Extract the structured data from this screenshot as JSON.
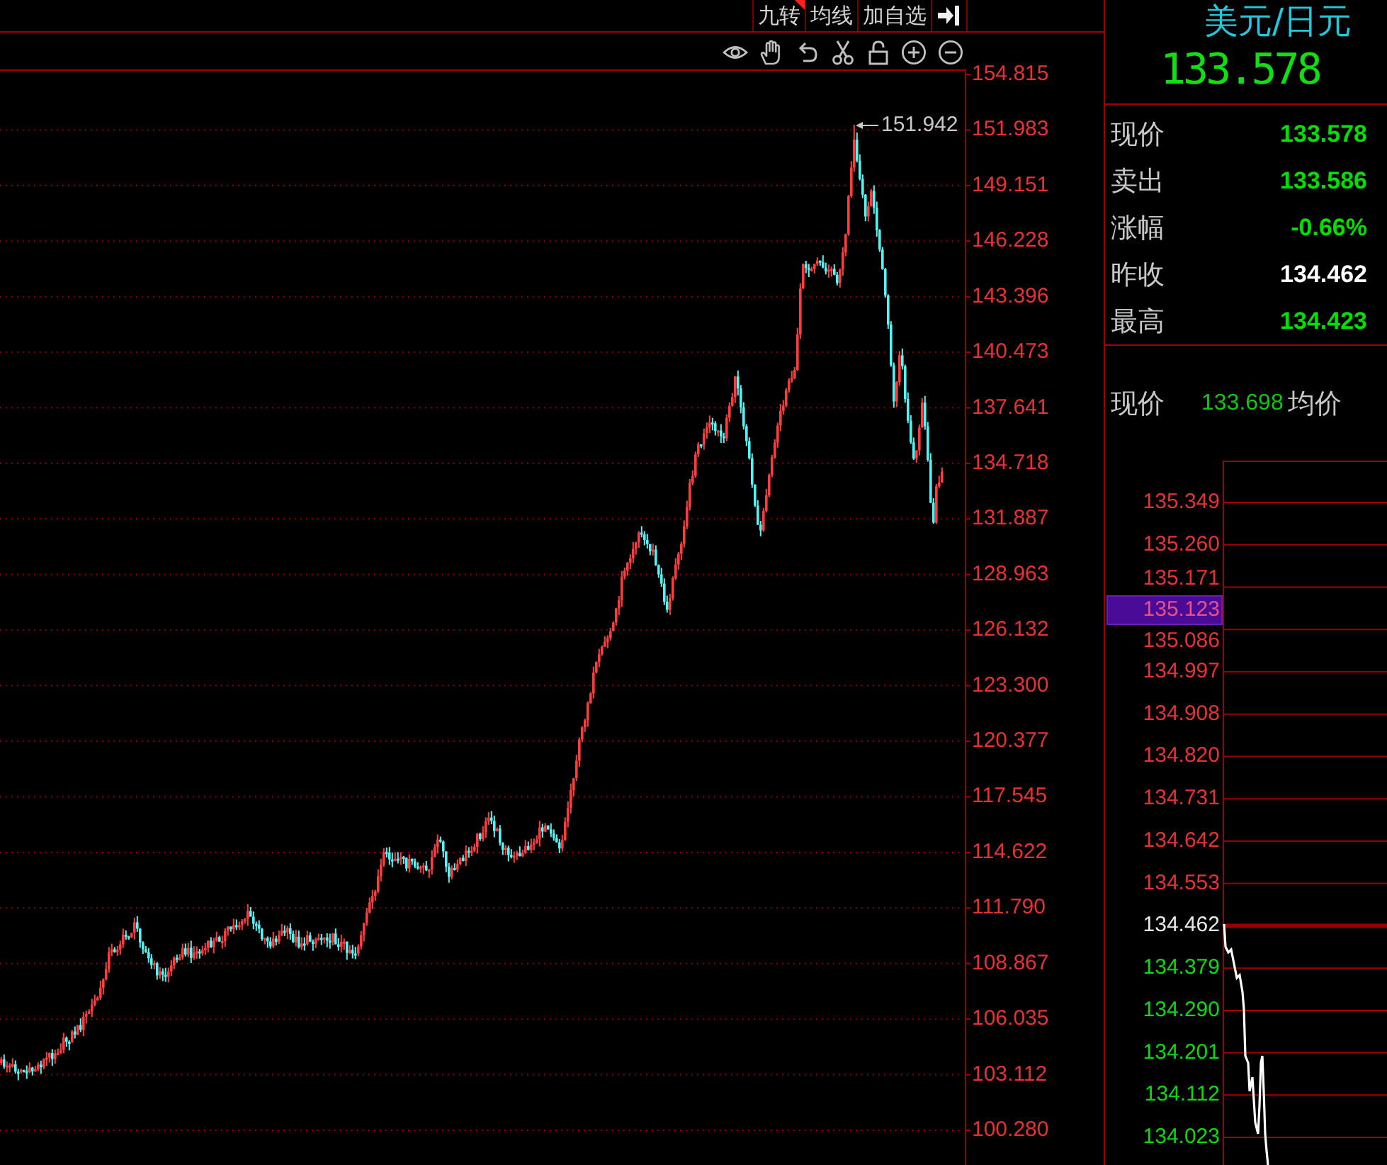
{
  "toolbar": {
    "buttons": [
      {
        "label": "九转",
        "flagged": true
      },
      {
        "label": "均线",
        "flagged": false
      },
      {
        "label": "加自选",
        "flagged": false
      }
    ]
  },
  "main_chart": {
    "axis_labels": [
      "154.815",
      "151.983",
      "149.151",
      "146.228",
      "143.396",
      "140.473",
      "137.641",
      "134.718",
      "131.887",
      "128.963",
      "126.132",
      "123.300",
      "120.377",
      "117.545",
      "114.622",
      "111.790",
      "108.867",
      "106.035",
      "103.112",
      "100.280"
    ],
    "peak_label": "151.942"
  },
  "quote_panel": {
    "symbol": "美元/日元",
    "last_price": "133.578",
    "rows": [
      {
        "label": "现价",
        "value": "133.578",
        "kind": "down"
      },
      {
        "label": "卖出",
        "value": "133.586",
        "kind": "down"
      },
      {
        "label": "涨幅",
        "value": "-0.66%",
        "kind": "down"
      },
      {
        "label": "昨收",
        "value": "134.462",
        "kind": "base"
      },
      {
        "label": "最高",
        "value": "134.423",
        "kind": "down"
      }
    ]
  },
  "intraday": {
    "price_label": "现价",
    "price_value": "133.698",
    "average_label": "均价",
    "axis_labels": [
      {
        "text": "135.349",
        "kind": "up"
      },
      {
        "text": "135.260",
        "kind": "up"
      },
      {
        "text": "135.171",
        "kind": "up"
      },
      {
        "text": "135.086",
        "kind": "up"
      },
      {
        "text": "134.997",
        "kind": "up"
      },
      {
        "text": "134.908",
        "kind": "up"
      },
      {
        "text": "134.820",
        "kind": "up"
      },
      {
        "text": "134.731",
        "kind": "up"
      },
      {
        "text": "134.642",
        "kind": "up"
      },
      {
        "text": "134.553",
        "kind": "up"
      },
      {
        "text": "134.462",
        "kind": "base"
      },
      {
        "text": "134.379",
        "kind": "down"
      },
      {
        "text": "134.290",
        "kind": "down"
      },
      {
        "text": "134.201",
        "kind": "down"
      },
      {
        "text": "134.112",
        "kind": "down"
      },
      {
        "text": "134.023",
        "kind": "down"
      }
    ],
    "cursor_label": "135.123"
  }
}
